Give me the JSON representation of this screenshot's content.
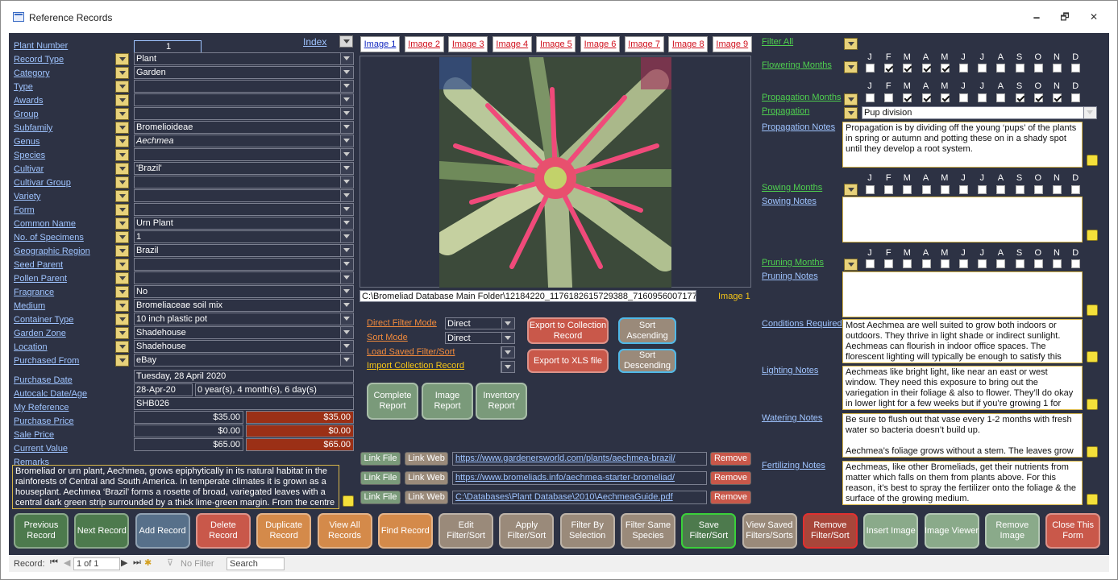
{
  "window": {
    "title": "Reference Records",
    "min": "🗕",
    "max": "🗗",
    "close": "✕"
  },
  "index": {
    "label": "Index"
  },
  "fields": [
    {
      "label": "Plant Number",
      "value": "1"
    },
    {
      "label": "Record Type",
      "value": "Plant"
    },
    {
      "label": "Category",
      "value": "Garden"
    },
    {
      "label": "Type",
      "value": ""
    },
    {
      "label": "Awards",
      "value": ""
    },
    {
      "label": "Group",
      "value": ""
    },
    {
      "label": "Subfamily",
      "value": "Bromelioideae"
    },
    {
      "label": "Genus",
      "value": "Aechmea"
    },
    {
      "label": "Species",
      "value": ""
    },
    {
      "label": "Cultivar",
      "value": "'Brazil'"
    },
    {
      "label": "Cultivar Group",
      "value": ""
    },
    {
      "label": "Variety",
      "value": ""
    },
    {
      "label": "Form",
      "value": ""
    },
    {
      "label": "Common Name",
      "value": "Urn Plant"
    },
    {
      "label": "No. of Specimens",
      "value": "1"
    },
    {
      "label": "Geographic Region",
      "value": "Brazil"
    },
    {
      "label": "Seed Parent",
      "value": ""
    },
    {
      "label": "Pollen Parent",
      "value": ""
    },
    {
      "label": "Fragrance",
      "value": "No"
    },
    {
      "label": "Medium",
      "value": "Bromeliaceae soil mix"
    },
    {
      "label": "Container Type",
      "value": "10 inch plastic pot"
    },
    {
      "label": "Garden Zone",
      "value": "Shadehouse"
    },
    {
      "label": "Location",
      "value": "Shadehouse"
    },
    {
      "label": "Purchased From",
      "value": "eBay"
    }
  ],
  "purchase_date": {
    "label": "Purchase Date",
    "value": "Tuesday, 28 April 2020"
  },
  "autocalc": {
    "label": "Autocalc Date/Age",
    "date": "28-Apr-20",
    "age": "0 year(s), 4 month(s), 6 day(s)"
  },
  "my_reference": {
    "label": "My Reference",
    "value": "SHB026"
  },
  "prices": [
    {
      "label": "Purchase Price",
      "value": "$35.00",
      "total": "$35.00"
    },
    {
      "label": "Sale Price",
      "value": "$0.00",
      "total": "$0.00"
    },
    {
      "label": "Current Value",
      "value": "$65.00",
      "total": "$65.00"
    }
  ],
  "remarks": {
    "label": "Remarks",
    "text": "Bromeliad or urn plant, Aechmea, grows epiphytically in its natural habitat in the rainforests of Central and South America. In temperate climates it is grown as a houseplant. Aechmea ‘Brazil’ forms a rosette of broad, variegated leaves with a central dark green strip surrounded by a thick lime-green margin. From the centre"
  },
  "image_tabs": [
    "Image 1",
    "Image 2",
    "Image 3",
    "Image 4",
    "Image 5",
    "Image 6",
    "Image 7",
    "Image 8",
    "Image 9"
  ],
  "image_path": "C:\\Bromeliad Database Main Folder\\12184220_1176182615729388_71609560071774",
  "image_caption": "Image 1",
  "filter": {
    "direct_filter_label": "Direct Filter Mode",
    "direct_filter_value": "Direct",
    "sort_mode_label": "Sort Mode",
    "sort_mode_value": "Direct",
    "load_saved_label": "Load Saved Filter/Sort",
    "import_label": "Import Collection Record",
    "export_collection": "Export to Collection Record",
    "export_xls": "Export to XLS file",
    "sort_asc": "Sort Ascending",
    "sort_desc": "Sort Descending"
  },
  "reports": [
    "Complete Report",
    "Image Report",
    "Inventory Report"
  ],
  "links": [
    {
      "url": "https://www.gardenersworld.com/plants/aechmea-brazil/"
    },
    {
      "url": "https://www.bromeliads.info/aechmea-starter-bromeliad/"
    },
    {
      "url": "C:\\Databases\\Plant Database\\2010\\AechmeaGuide.pdf"
    }
  ],
  "link_buttons": {
    "file": "Link File",
    "web": "Link Web",
    "remove": "Remove"
  },
  "months": [
    "J",
    "F",
    "M",
    "A",
    "M",
    "J",
    "J",
    "A",
    "S",
    "O",
    "N",
    "D"
  ],
  "filter_all": "Filter All",
  "flowering": {
    "label": "Flowering Months",
    "checked": [
      false,
      true,
      true,
      true,
      true,
      false,
      false,
      false,
      false,
      false,
      false,
      false
    ]
  },
  "propagation_months": {
    "label": "Propagation Months",
    "checked": [
      false,
      false,
      true,
      true,
      true,
      false,
      false,
      false,
      true,
      true,
      true,
      false
    ]
  },
  "propagation": {
    "label": "Propagation",
    "value": "Pup division"
  },
  "propagation_notes": {
    "label": "Propagation Notes",
    "text": "Propagation is by dividing off the young ‘pups’ of the plants in spring or autumn and potting these on in a shady spot until they develop a root system."
  },
  "sowing": {
    "label": "Sowing Months",
    "checked": [
      false,
      false,
      false,
      false,
      false,
      false,
      false,
      false,
      false,
      false,
      false,
      false
    ]
  },
  "sowing_notes": {
    "label": "Sowing Notes",
    "text": ""
  },
  "pruning": {
    "label": "Pruning Months",
    "checked": [
      false,
      false,
      false,
      false,
      false,
      false,
      false,
      false,
      false,
      false,
      false,
      false
    ]
  },
  "pruning_notes": {
    "label": "Pruning Notes",
    "text": ""
  },
  "conditions": {
    "label": "Conditions Required",
    "text": "Most Aechmea are well suited to grow both indoors or outdoors. They thrive in light shade or indirect sunlight. Aechmeas can flourish in indoor office spaces. The florescent lighting will typically be enough to satisfy this"
  },
  "lighting": {
    "label": "Lighting Notes",
    "text": "Aechmeas like bright light, like near an east or west window. They need this exposure to bring out the variegation in their foliage & also to flower. They’ll do okay in lower light for a few weeks but if you’re growing 1 for"
  },
  "watering": {
    "label": "Watering Notes",
    "text": "Be sure to flush out that vase every 1-2 months with fresh water so bacteria doesn’t build up.\n\nAechmea’s foliage grows without a stem. The leaves grow"
  },
  "fertilizing": {
    "label": "Fertilizing Notes",
    "text": "Aechmeas, like other Bromeliads, get their nutrients from matter which falls on them from plants above. For this reason, it’s best to spray the fertilizer onto the foliage & the surface of the growing medium."
  },
  "bottom_buttons": [
    "Previous Record",
    "Next Record",
    "Add Record",
    "Delete Record",
    "Duplicate Record",
    "View All Records",
    "Find Record",
    "Edit Filter/Sort",
    "Apply Filter/Sort",
    "Filter By Selection",
    "Filter  Same Species",
    "Save Filter/Sort",
    "View Saved Filters/Sorts",
    "Remove Filter/Sort",
    "Insert Image",
    "Image Viewer",
    "Remove Image",
    "Close This Form"
  ],
  "nav": {
    "record_label": "Record:",
    "position": "1 of 1",
    "filter": "No Filter",
    "search": "Search"
  }
}
